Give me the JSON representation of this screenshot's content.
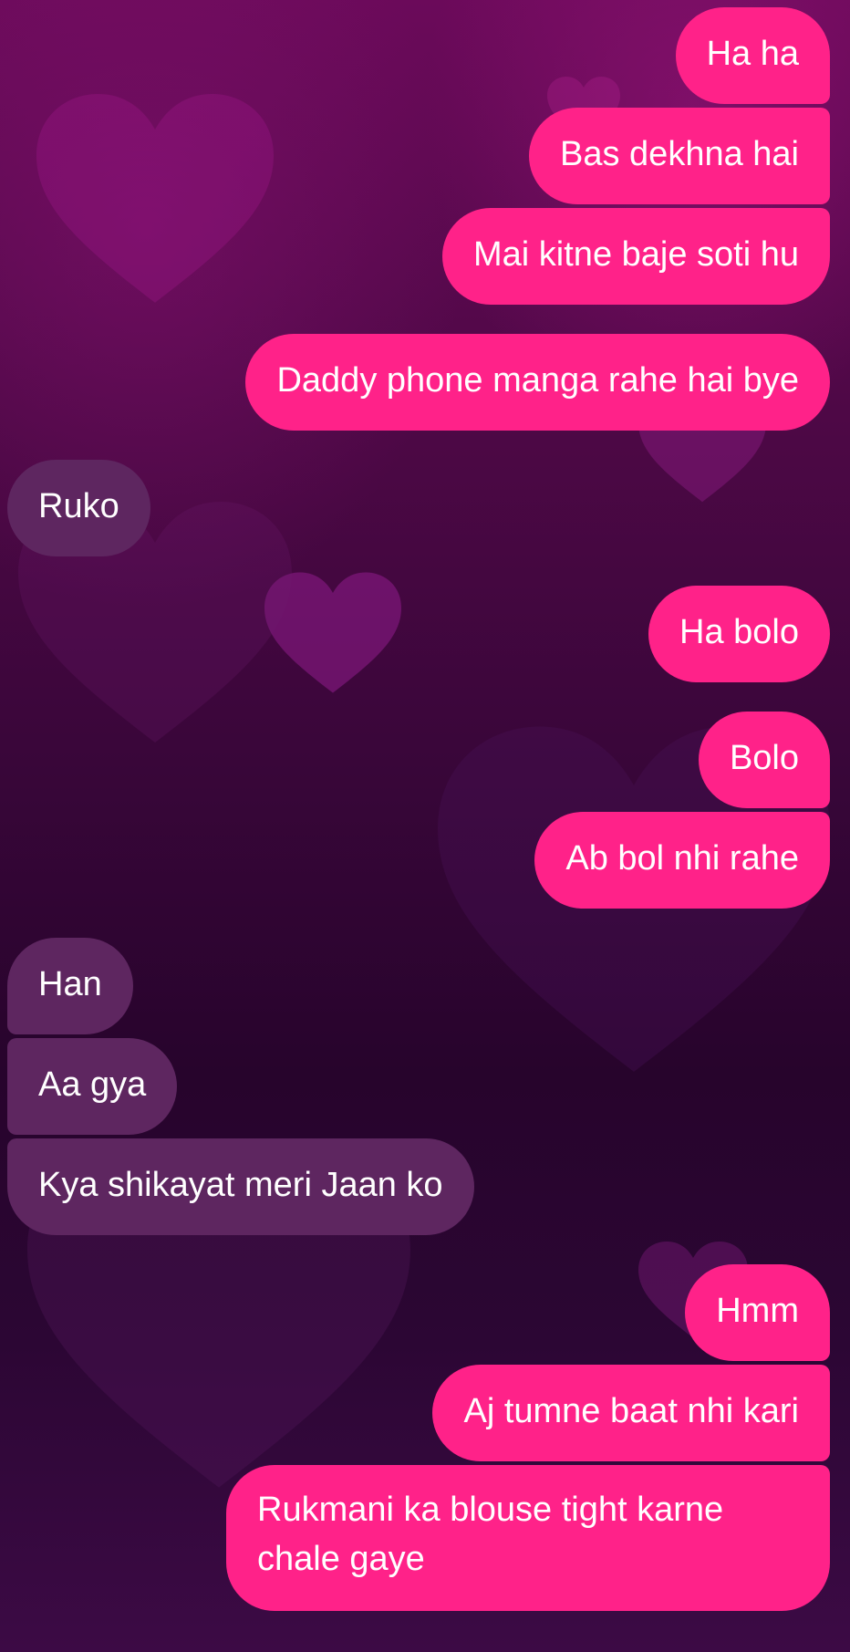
{
  "background": {
    "top_color": "#6b0a5a",
    "bottom_color": "#27042c",
    "heart_color": "#8a1a7e"
  },
  "colors": {
    "sent_bubble": "#ff2289",
    "received_bubble": "#5e2660",
    "text": "#ffffff"
  },
  "messages": [
    {
      "sender": "me",
      "text": "Ha ha"
    },
    {
      "sender": "me",
      "text": "Bas dekhna hai"
    },
    {
      "sender": "me",
      "text": "Mai kitne baje soti hu"
    },
    {
      "sender": "me",
      "text": "Daddy phone manga rahe hai bye"
    },
    {
      "sender": "them",
      "text": "Ruko"
    },
    {
      "sender": "me",
      "text": "Ha bolo"
    },
    {
      "sender": "me",
      "text": "Bolo"
    },
    {
      "sender": "me",
      "text": "Ab bol nhi rahe"
    },
    {
      "sender": "them",
      "text": "Han"
    },
    {
      "sender": "them",
      "text": "Aa gya"
    },
    {
      "sender": "them",
      "text": "Kya shikayat meri Jaan ko"
    },
    {
      "sender": "me",
      "text": "Hmm"
    },
    {
      "sender": "me",
      "text": "Aj tumne baat nhi kari"
    },
    {
      "sender": "me",
      "text": "Rukmani ka blouse tight karne chale gaye"
    }
  ]
}
